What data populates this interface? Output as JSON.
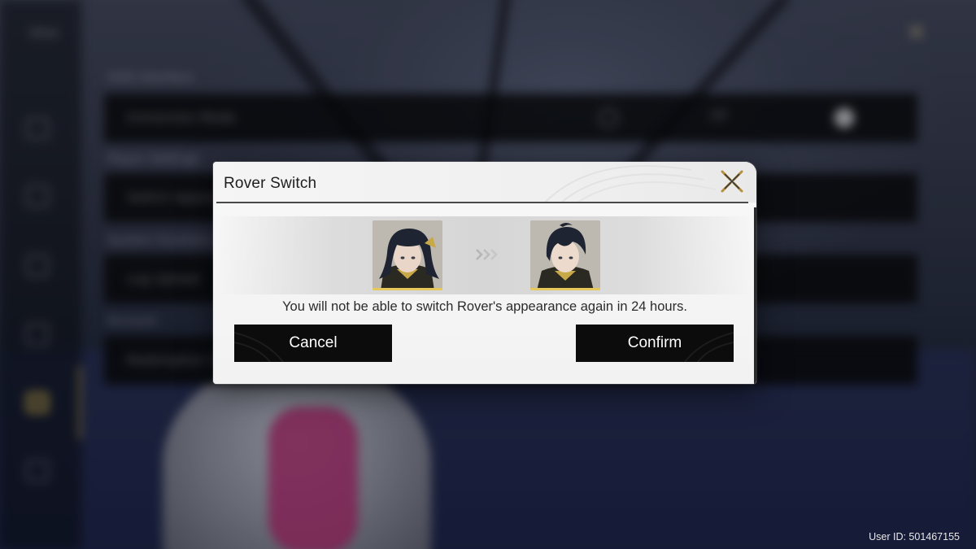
{
  "background": {
    "panel_title": "Other",
    "sections": [
      "HUD Interface",
      "Player Settings",
      "System Functions",
      "Account"
    ],
    "rows": [
      {
        "label": "Immersion Mode",
        "value": "Off"
      },
      {
        "label": "Switch Appearance",
        "value": ""
      },
      {
        "label": "Log Upload",
        "value": ""
      },
      {
        "label": "Redemption Code",
        "value": ""
      }
    ]
  },
  "dialog": {
    "title": "Rover Switch",
    "message": "You will not be able to switch Rover's appearance again in 24 hours.",
    "cancel_label": "Cancel",
    "confirm_label": "Confirm",
    "from_portrait": "female-rover-portrait",
    "to_portrait": "male-rover-portrait"
  },
  "footer": {
    "user_id": "User ID: 501467155"
  },
  "colors": {
    "accent_gold": "#c9a94a",
    "button_bg": "#0c0c0c",
    "dialog_bg": "#f3f3f3"
  }
}
